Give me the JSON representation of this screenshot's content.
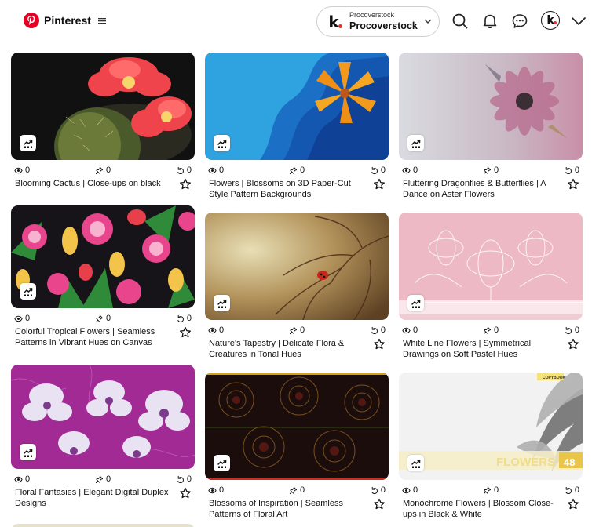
{
  "header": {
    "brand": "Pinterest",
    "account_label": "Procoverstock",
    "account_name": "Procoverstock",
    "icons": [
      "pinterest-logo-icon",
      "menu-icon",
      "chevron-down-icon",
      "search-icon",
      "bell-icon",
      "chat-icon",
      "avatar",
      "chevron-down-icon"
    ]
  },
  "pins": [
    {
      "title": "Blooming Cactus | Close-ups on black",
      "views": "0",
      "pins": "0",
      "saves": "0"
    },
    {
      "title": "Flowers | Blossoms on 3D Paper-Cut Style Pattern Backgrounds",
      "views": "0",
      "pins": "0",
      "saves": "0"
    },
    {
      "title": "Fluttering Dragonflies & Butterflies | A Dance on Aster Flowers",
      "views": "0",
      "pins": "0",
      "saves": "0"
    },
    {
      "title": "Colorful Tropical Flowers | Seamless Patterns in Vibrant Hues on Canvas",
      "views": "0",
      "pins": "0",
      "saves": "0"
    },
    {
      "title": "Nature's Tapestry | Delicate Flora & Creatures in Tonal Hues",
      "views": "0",
      "pins": "0",
      "saves": "0"
    },
    {
      "title": "White Line Flowers | Symmetrical Drawings on Soft Pastel Hues",
      "views": "0",
      "pins": "0",
      "saves": "0"
    },
    {
      "title": "Floral Fantasies | Elegant Digital Duplex Designs",
      "views": "0",
      "pins": "0",
      "saves": "0"
    },
    {
      "title": "Blossoms of Inspiration | Seamless Patterns of Floral Art",
      "views": "0",
      "pins": "0",
      "saves": "0"
    },
    {
      "title": "Monochrome Flowers | Blossom Close-ups in Black & White",
      "views": "0",
      "pins": "0",
      "saves": "0"
    }
  ],
  "image_text": {
    "flowers_banner": "FLOWERS",
    "banner_number": "48",
    "copybook_label": "COPYBOOK"
  },
  "colors": {
    "brand_red": "#e60023",
    "accent_dot": "#e2332f"
  }
}
